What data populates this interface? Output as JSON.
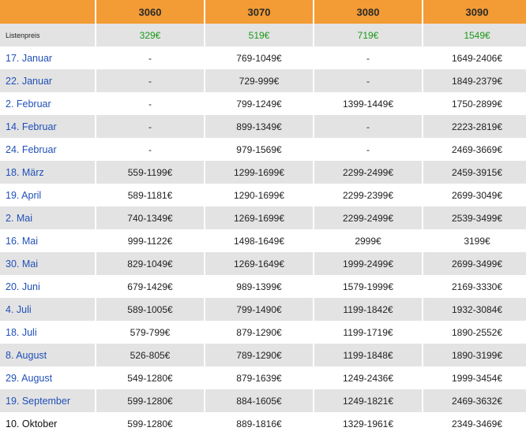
{
  "header": {
    "columns": [
      "3060",
      "3070",
      "3080",
      "3090"
    ]
  },
  "list_price": {
    "label": "Listenpreis",
    "values": [
      "329€",
      "519€",
      "719€",
      "1549€"
    ]
  },
  "rows": [
    {
      "date": "17. Januar",
      "values": [
        "-",
        "769-1049€",
        "-",
        "1649-2406€"
      ]
    },
    {
      "date": "22. Januar",
      "values": [
        "-",
        "729-999€",
        "-",
        "1849-2379€"
      ]
    },
    {
      "date": "2. Februar",
      "values": [
        "-",
        "799-1249€",
        "1399-1449€",
        "1750-2899€"
      ]
    },
    {
      "date": "14. Februar",
      "values": [
        "-",
        "899-1349€",
        "-",
        "2223-2819€"
      ]
    },
    {
      "date": "24. Februar",
      "values": [
        "-",
        "979-1569€",
        "-",
        "2469-3669€"
      ]
    },
    {
      "date": "18. März",
      "values": [
        "559-1199€",
        "1299-1699€",
        "2299-2499€",
        "2459-3915€"
      ]
    },
    {
      "date": "19. April",
      "values": [
        "589-1181€",
        "1290-1699€",
        "2299-2399€",
        "2699-3049€"
      ]
    },
    {
      "date": "2. Mai",
      "values": [
        "740-1349€",
        "1269-1699€",
        "2299-2499€",
        "2539-3499€"
      ]
    },
    {
      "date": "16. Mai",
      "values": [
        "999-1122€",
        "1498-1649€",
        "2999€",
        "3199€"
      ]
    },
    {
      "date": "30. Mai",
      "values": [
        "829-1049€",
        "1269-1649€",
        "1999-2499€",
        "2699-3499€"
      ]
    },
    {
      "date": "20. Juni",
      "values": [
        "679-1429€",
        "989-1399€",
        "1579-1999€",
        "2169-3330€"
      ]
    },
    {
      "date": "4. Juli",
      "values": [
        "589-1005€",
        "799-1490€",
        "1199-1842€",
        "1932-3084€"
      ]
    },
    {
      "date": "18. Juli",
      "values": [
        "579-799€",
        "879-1290€",
        "1199-1719€",
        "1890-2552€"
      ]
    },
    {
      "date": "8. August",
      "values": [
        "526-805€",
        "789-1290€",
        "1199-1848€",
        "1890-3199€"
      ]
    },
    {
      "date": "29. August",
      "values": [
        "549-1280€",
        "879-1639€",
        "1249-2436€",
        "1999-3454€"
      ]
    },
    {
      "date": "19. September",
      "values": [
        "599-1280€",
        "884-1605€",
        "1249-1821€",
        "2469-3632€"
      ]
    },
    {
      "date": "10. Oktober",
      "values": [
        "599-1280€",
        "889-1816€",
        "1329-1961€",
        "2349-3469€"
      ]
    }
  ],
  "colors": {
    "header_bg": "#f39b34",
    "date_link": "#2050b8",
    "msrp_green": "#1a9a1a",
    "row_alt": "#e3e3e3"
  }
}
